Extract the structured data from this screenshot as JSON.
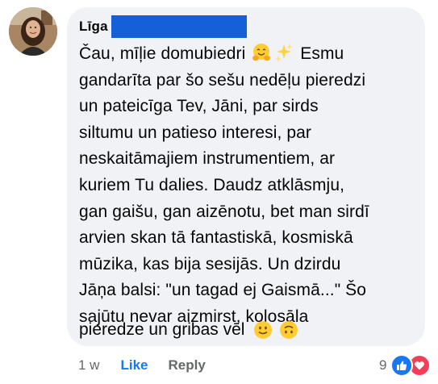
{
  "comment": {
    "author": "Līga",
    "text_lines": [
      "Čau, mīļie domubiedri",
      "gandarīta par šo sešu nedēļu pieredzi",
      "un pateicīga Tev, Jāni, par sirds",
      "siltumu un patieso interesi, par",
      "neskaitāmajiem instrumentiem, ar",
      "kuriem Tu dalies. Daudz atklāsmju,",
      "gan gaišu, gan aizēnotu, bet man sirdī",
      "arvien skan tā fantastiskā, kosmiskā",
      "mūzika, kas bija sesijās. Un dzirdu",
      "Jāņa balsi: \"un tagad ej Gaismā...\" Šo",
      "sajūtu nevar aizmirst, kolosāla"
    ],
    "first_line_tail": "Esmu",
    "last_line": "pieredze un gribas vēl",
    "emojis": {
      "first_line": [
        "hugging-face-icon",
        "sparkles-icon"
      ],
      "last_line": [
        "slightly-smiling-face-icon",
        "upside-down-face-icon"
      ]
    }
  },
  "footer": {
    "time": "1 w",
    "like_label": "Like",
    "reply_label": "Reply"
  },
  "reactions": {
    "count": "9",
    "types": [
      "like-icon",
      "love-icon"
    ]
  },
  "colors": {
    "bubble": "#f0f2f5",
    "like_blue": "#1877f2",
    "love_red": "#f33e58",
    "redaction": "#1560d9",
    "meta_gray": "#65676b"
  }
}
